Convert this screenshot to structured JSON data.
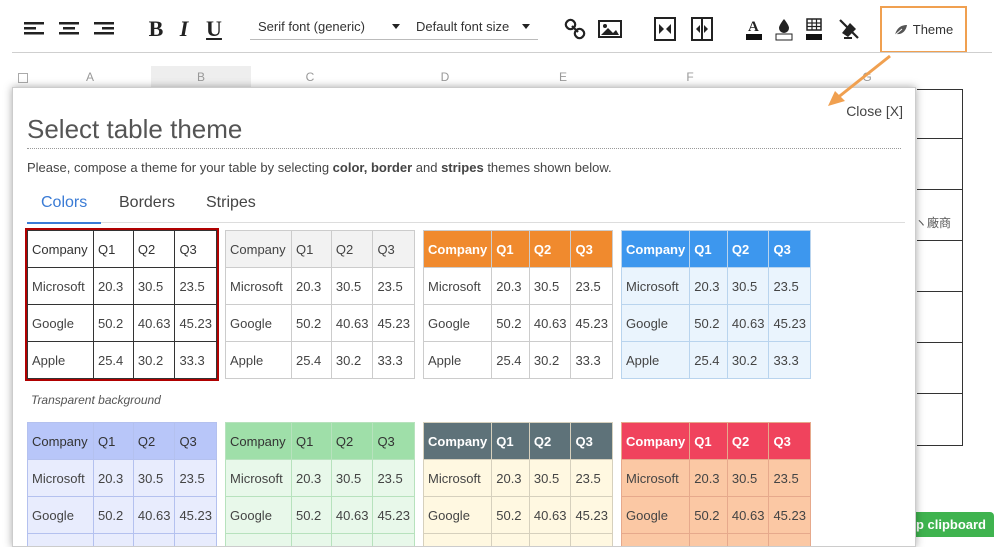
{
  "toolbar": {
    "align_left_icon": "align-left-icon",
    "align_center_icon": "align-center-icon",
    "align_right_icon": "align-right-icon",
    "bold": "B",
    "italic": "I",
    "underline": "U",
    "font_select": "Serif font (generic)",
    "size_select": "Default font size",
    "theme_label": "Theme"
  },
  "sheet": {
    "columns": [
      "A",
      "B",
      "C",
      "D",
      "E",
      "F",
      "G"
    ],
    "cjk_text": "ヽ廠商",
    "clipboard_label": "p clipboard"
  },
  "modal": {
    "close_label": "Close [X]",
    "title": "Select table theme",
    "desc_before": "Please, compose a theme for your table by selecting ",
    "desc_b1": "color, border",
    "desc_mid": " and ",
    "desc_b2": "stripes",
    "desc_after": " themes shown below.",
    "tabs": [
      "Colors",
      "Borders",
      "Stripes"
    ],
    "active_tab": "Colors",
    "caption": "Transparent background"
  },
  "table": {
    "header": [
      "Company",
      "Q1",
      "Q2",
      "Q3"
    ],
    "rows": [
      [
        "Microsoft",
        "20.3",
        "30.5",
        "23.5"
      ],
      [
        "Google",
        "50.2",
        "40.63",
        "45.23"
      ],
      [
        "Apple",
        "25.4",
        "30.2",
        "33.3"
      ]
    ]
  },
  "themes": [
    {
      "name": "transparent",
      "selected": true,
      "head_bg": "#ffffff",
      "head_fg": "#333333",
      "body_bg": "#ffffff",
      "border": "#333333"
    },
    {
      "name": "light-gray",
      "selected": false,
      "head_bg": "#f2f2f2",
      "head_fg": "#444444",
      "body_bg": "#ffffff",
      "border": "#cccccc"
    },
    {
      "name": "orange",
      "selected": false,
      "head_bg": "#f08a2e",
      "head_fg": "#ffffff",
      "body_bg": "#ffffff",
      "border": "#cccccc"
    },
    {
      "name": "blue",
      "selected": false,
      "head_bg": "#3d97ee",
      "head_fg": "#ffffff",
      "body_bg": "#eaf4fd",
      "border": "#b9d4ee"
    },
    {
      "name": "lavender",
      "selected": false,
      "head_bg": "#b8c6f9",
      "head_fg": "#333333",
      "body_bg": "#e8ecfd",
      "border": "#b4c1ef"
    },
    {
      "name": "green",
      "selected": false,
      "head_bg": "#9fdfa9",
      "head_fg": "#333333",
      "body_bg": "#e8f8ea",
      "border": "#b7e2bd"
    },
    {
      "name": "slate",
      "selected": false,
      "head_bg": "#5e7279",
      "head_fg": "#ffffff",
      "body_bg": "#fff8e1",
      "border": "#d6d0bd"
    },
    {
      "name": "red",
      "selected": false,
      "head_bg": "#f0435d",
      "head_fg": "#ffffff",
      "body_bg": "#fbc8a4",
      "border": "#e6a98c"
    }
  ],
  "colors": {
    "accent": "#3a7bd5",
    "highlight": "#f0a050",
    "clipboard": "#3fb34f"
  }
}
